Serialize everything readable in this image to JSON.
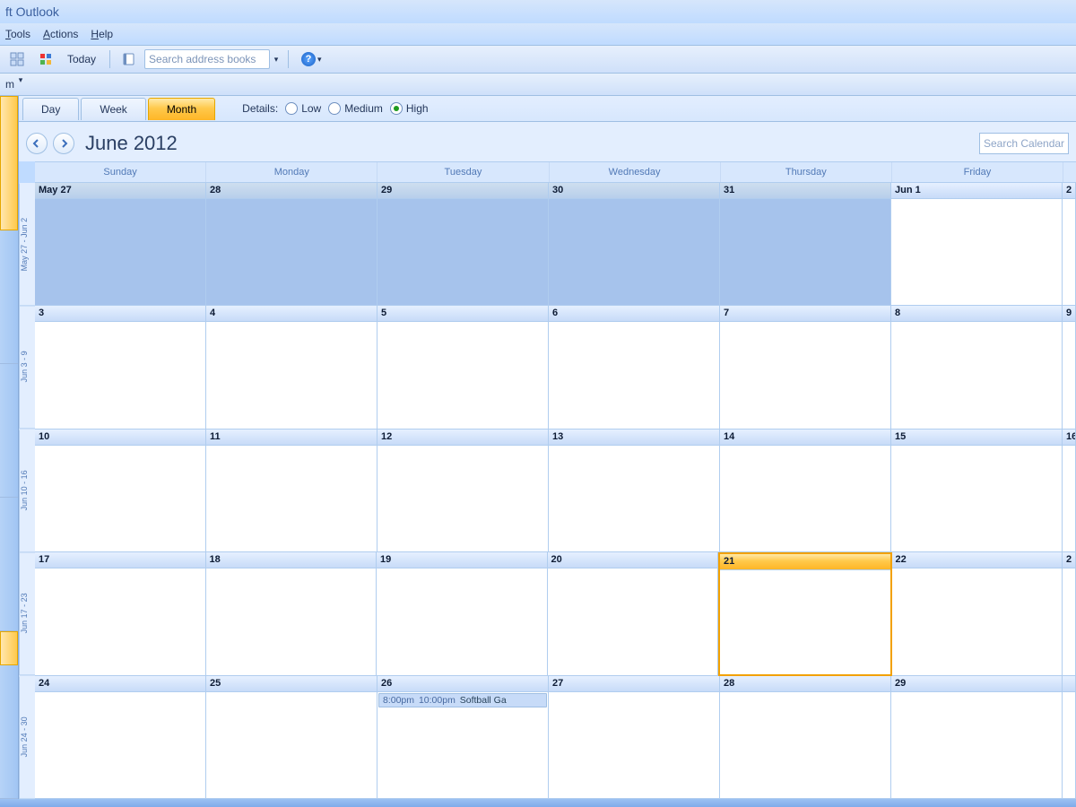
{
  "title": "ft Outlook",
  "menu": {
    "tools": "Tools",
    "actions": "Actions",
    "help": "Help"
  },
  "toolbar": {
    "today": "Today",
    "search_addr_ph": "Search address books",
    "m_label": "m"
  },
  "view": {
    "day": "Day",
    "week": "Week",
    "month": "Month",
    "details_label": "Details:",
    "low": "Low",
    "medium": "Medium",
    "high": "High"
  },
  "cal": {
    "title": "June 2012",
    "search_ph": "Search Calendar",
    "dow": [
      "Sunday",
      "Monday",
      "Tuesday",
      "Wednesday",
      "Thursday",
      "Friday",
      ""
    ],
    "week_labels": [
      "May 27 - Jun 2",
      "Jun 3 - 9",
      "Jun 10 - 16",
      "Jun 17 - 23",
      "Jun 24 - 30"
    ],
    "weeks": [
      [
        {
          "label": "May 27",
          "prev": true
        },
        {
          "label": "28",
          "prev": true
        },
        {
          "label": "29",
          "prev": true
        },
        {
          "label": "30",
          "prev": true
        },
        {
          "label": "31",
          "prev": true
        },
        {
          "label": "Jun 1"
        },
        {
          "label": "2"
        }
      ],
      [
        {
          "label": "3"
        },
        {
          "label": "4"
        },
        {
          "label": "5"
        },
        {
          "label": "6"
        },
        {
          "label": "7"
        },
        {
          "label": "8"
        },
        {
          "label": "9"
        }
      ],
      [
        {
          "label": "10"
        },
        {
          "label": "11"
        },
        {
          "label": "12"
        },
        {
          "label": "13"
        },
        {
          "label": "14"
        },
        {
          "label": "15"
        },
        {
          "label": "16"
        }
      ],
      [
        {
          "label": "17"
        },
        {
          "label": "18"
        },
        {
          "label": "19"
        },
        {
          "label": "20"
        },
        {
          "label": "21",
          "today": true
        },
        {
          "label": "22"
        },
        {
          "label": "2"
        }
      ],
      [
        {
          "label": "24"
        },
        {
          "label": "25"
        },
        {
          "label": "26",
          "event": {
            "start": "8:00pm",
            "end": "10:00pm",
            "title": "Softball Ga"
          }
        },
        {
          "label": "27"
        },
        {
          "label": "28"
        },
        {
          "label": "29"
        },
        {
          "label": ""
        }
      ]
    ]
  }
}
